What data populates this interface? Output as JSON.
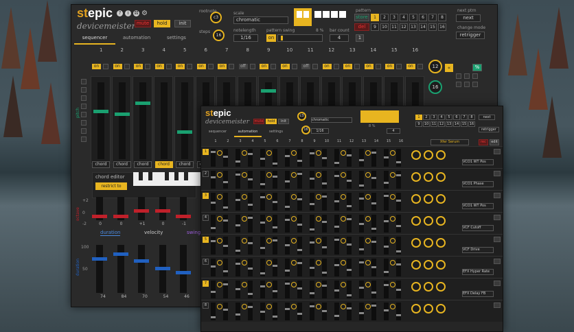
{
  "app": {
    "logo_st": "st",
    "logo_epic": "epic",
    "subtitle": "devicemeister",
    "icons": [
      "help-icon",
      "info-icon",
      "dice-icon",
      "gear-icon"
    ]
  },
  "top": {
    "mute": "mute",
    "hold": "hold",
    "init": "init",
    "rootnote_label": "rootnote",
    "rootnote_value": "c3",
    "scale_label": "scale",
    "scale_value": "chromatic",
    "steps_label": "steps",
    "steps_value": "16",
    "notelength_label": "notelength",
    "notelength_value": "1/16",
    "pattern_swing_label": "pattern swing",
    "pattern_swing_value": "8 %",
    "swing_on": "on",
    "bar_count_label": "bar count",
    "bar_count_value": "4",
    "bar_count_small": "1",
    "pattern_label": "pattern",
    "store": "store",
    "del": "del",
    "pattern_numbers": [
      "1",
      "2",
      "3",
      "4",
      "5",
      "6",
      "7",
      "8",
      "9",
      "10",
      "11",
      "12",
      "13",
      "14",
      "15",
      "16"
    ],
    "next_ptrn_label": "next ptrn",
    "next_ptrn_value": "next",
    "change_mode_label": "change mode",
    "change_mode_value": "retrigger"
  },
  "tabs": {
    "sequencer": "sequencer",
    "automation": "automation",
    "settings": "settings"
  },
  "steps": [
    "1",
    "2",
    "3",
    "4",
    "5",
    "6",
    "7",
    "8",
    "9",
    "10",
    "11",
    "12",
    "13",
    "14",
    "15",
    "16"
  ],
  "toggles": [
    "on",
    "on",
    "on",
    "on",
    "on",
    "on",
    "on",
    "off",
    "on",
    "on",
    "off",
    "on",
    "on",
    "on",
    "on",
    "on"
  ],
  "left_labels": {
    "pitch": "pitch",
    "octave": "octave",
    "duration": "duration"
  },
  "chord_labels": [
    "chord",
    "chord",
    "chord",
    "chord",
    "chord",
    "chord"
  ],
  "chord_editor": {
    "title": "chord editor",
    "restrict": "restrict to scale"
  },
  "octave": {
    "scale_top": "+2",
    "scale_mid": "0",
    "scale_bot": "-2",
    "values": [
      "0",
      "0",
      "+1",
      "0",
      "-1"
    ]
  },
  "duration": {
    "tabs": [
      "duration",
      "velocity",
      "swing"
    ],
    "scale_top": "100",
    "scale_mid": "50",
    "values": [
      "74",
      "84",
      "70",
      "54",
      "46"
    ]
  },
  "right_knobs": {
    "k1": "12",
    "k2": "16",
    "percent": "%"
  },
  "second": {
    "rootnote_value": "c3",
    "scale_value": "chromatic",
    "steps_value": "16",
    "notelength_value": "1/16",
    "pattern_swing_value": "8 %",
    "bar_count_value": "4",
    "next_ptrn_value": "next",
    "change_mode_value": "retrigger",
    "active_tab": "automation",
    "xfer_button": "Xfer Serum",
    "rec": "rec",
    "edit": "edit",
    "lanes": [
      {
        "num": "1",
        "target": "VCO1 WT Pos"
      },
      {
        "num": "2",
        "target": "VCO1 Phase"
      },
      {
        "num": "3",
        "target": "VCO1 WT Pos"
      },
      {
        "num": "4",
        "target": "VCF Cutoff"
      },
      {
        "num": "5",
        "target": "VCF Drive"
      },
      {
        "num": "6",
        "target": "EFX Hyper Rate"
      },
      {
        "num": "7",
        "target": "EFX Delay FB"
      },
      {
        "num": "8",
        "target": ""
      }
    ]
  },
  "colors": {
    "accent": "#e8b520",
    "pitch_green": "#1aa070",
    "octave_red": "#c0202a",
    "duration_blue": "#2060c0"
  }
}
